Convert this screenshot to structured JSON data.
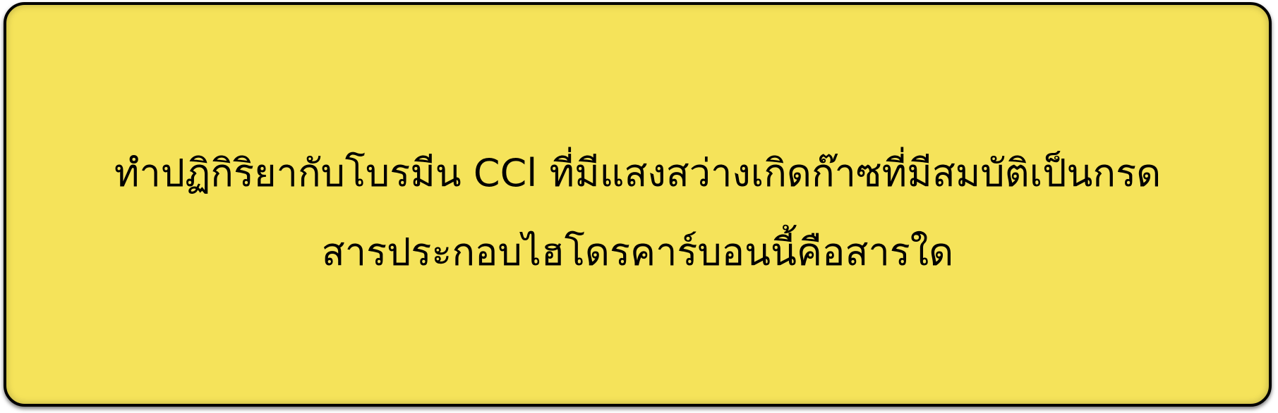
{
  "card": {
    "background_color": "#f5e35a",
    "border_color": "#000000"
  },
  "question": {
    "line1": "ทำปฏิกิริยากับโบรมีน CCl ที่มีแสงสว่างเกิดก๊าซที่มีสมบัติเป็นกรด",
    "line2": "สารประกอบไฮโดรคาร์บอนนี้คือสารใด"
  }
}
